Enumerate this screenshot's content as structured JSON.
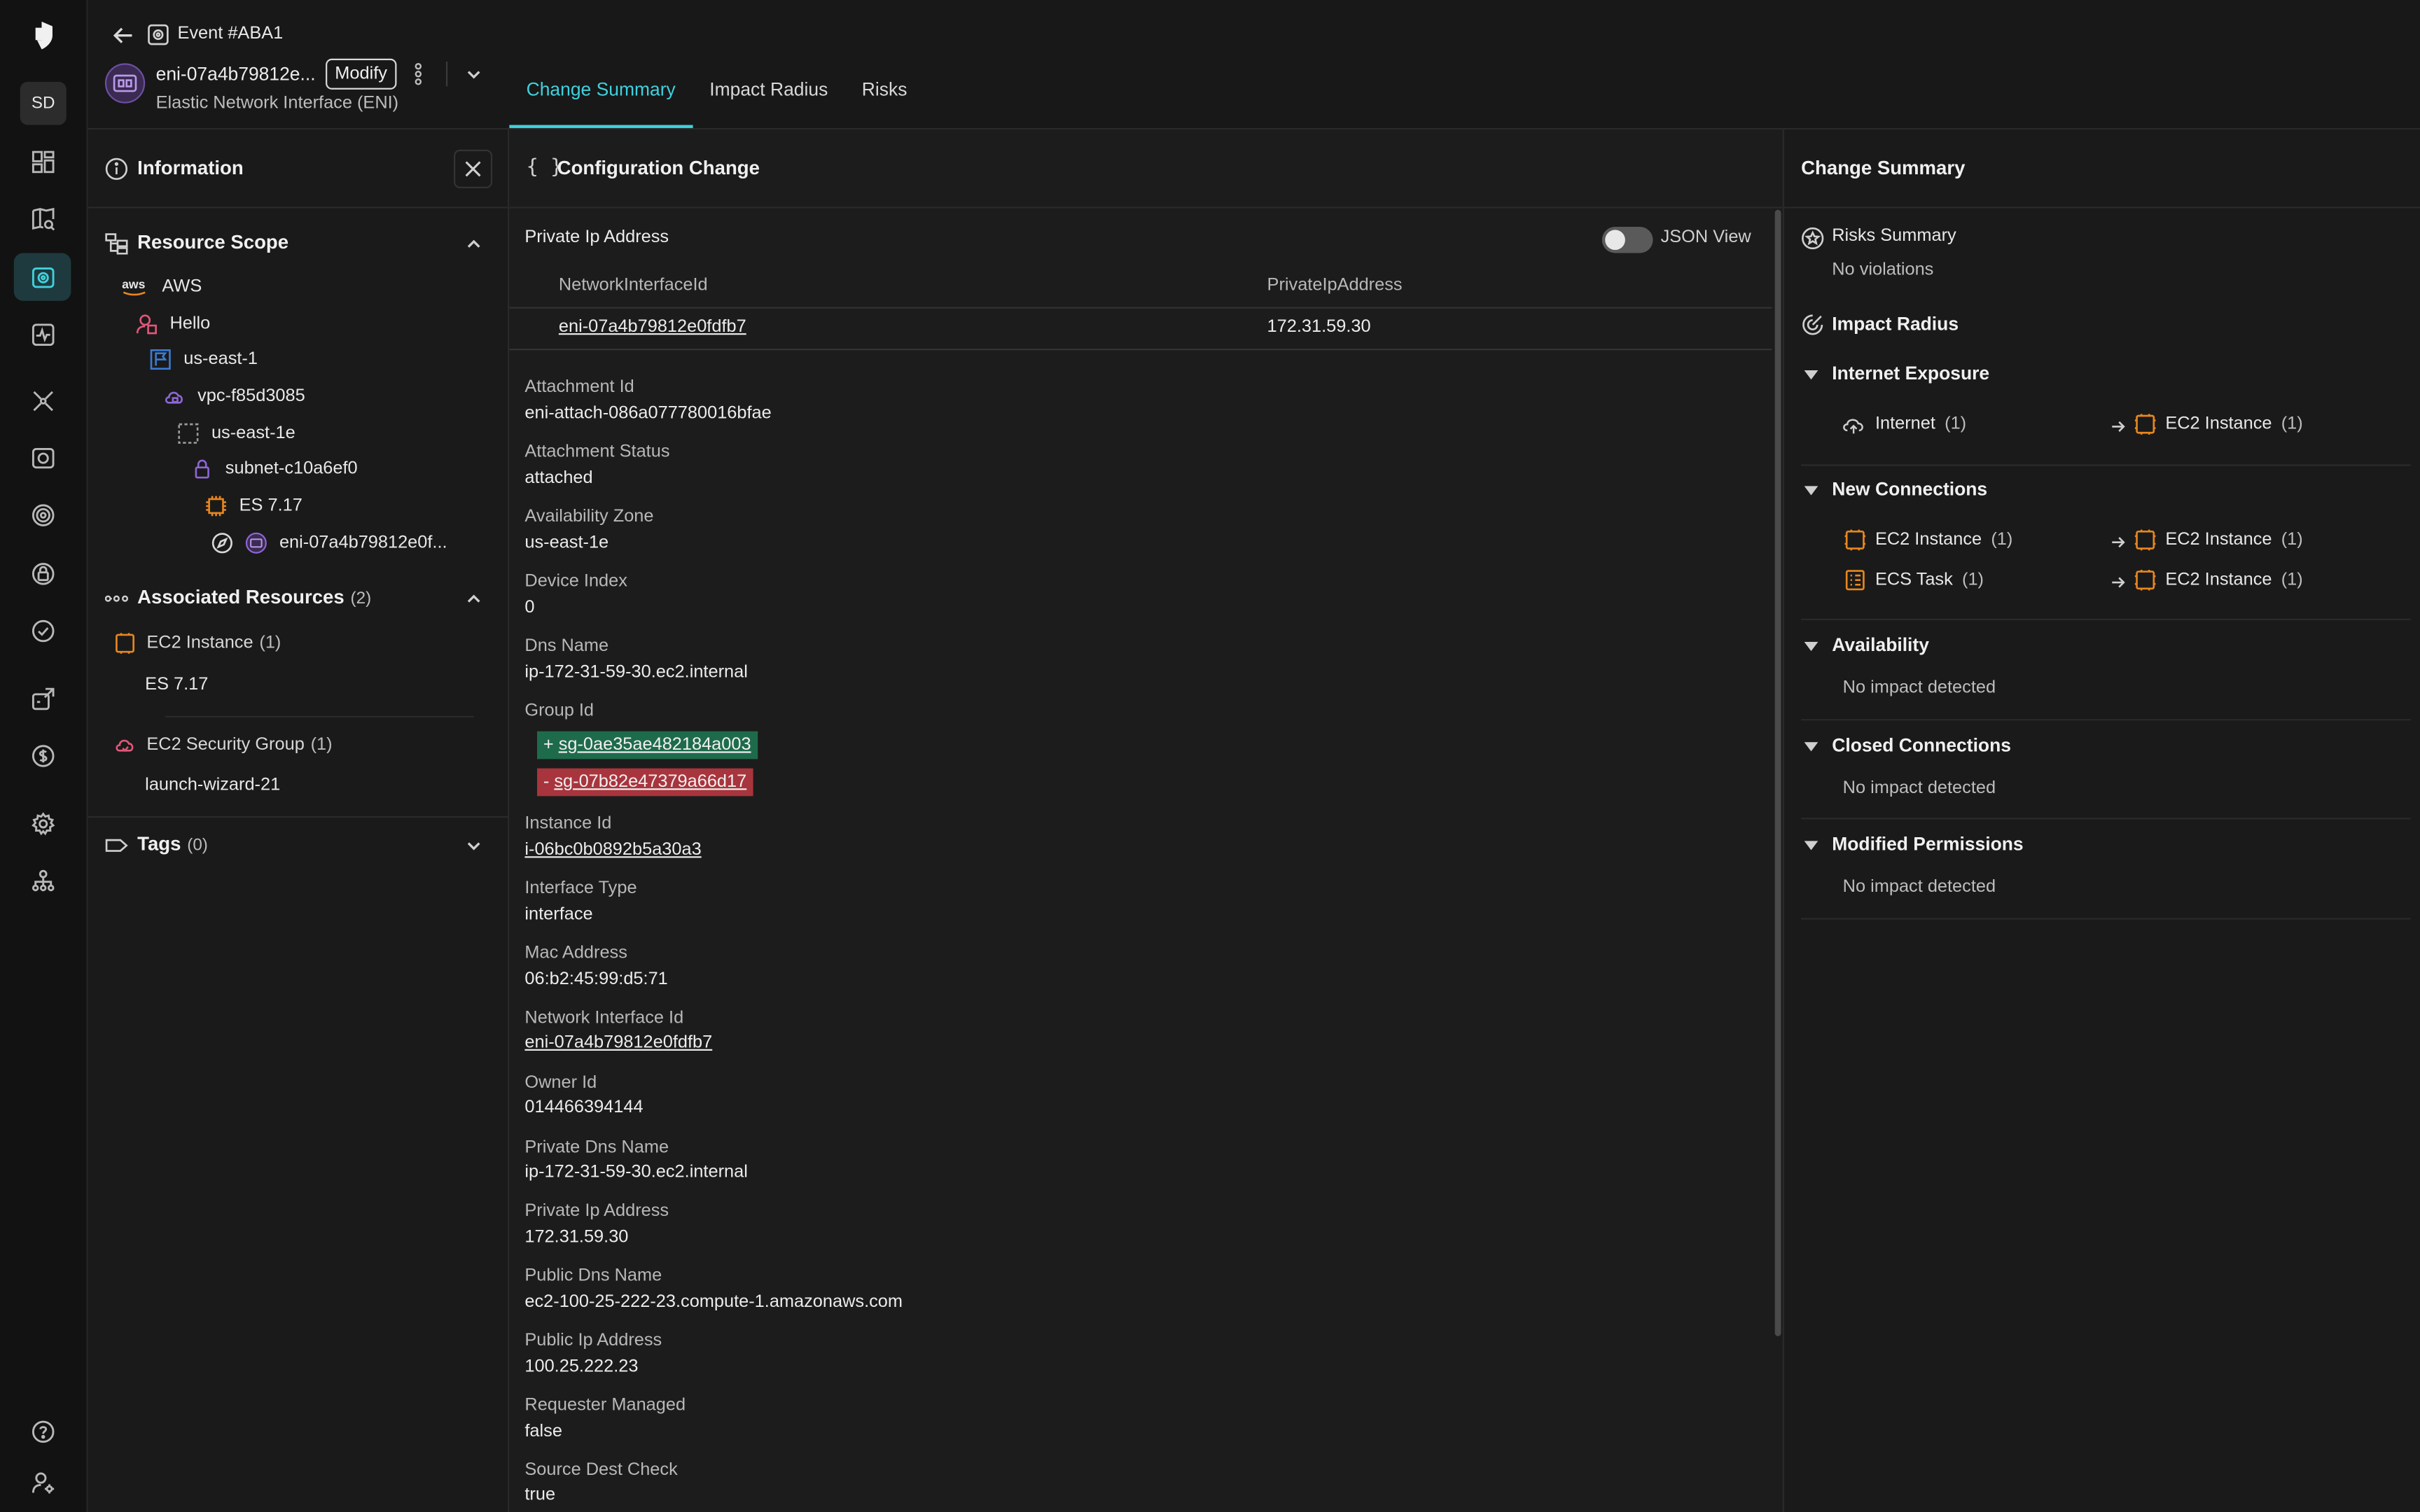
{
  "colors": {
    "accent": "#3fd1dd",
    "added": "#1e6b4c",
    "removed": "#a8353d",
    "aws_orange": "#e8871e",
    "purple": "#8d66d6",
    "pink": "#e0577a"
  },
  "rail": {
    "avatar": "SD"
  },
  "header": {
    "event_title": "Event #ABA1",
    "resource_name": "eni-07a4b79812e...",
    "modify_label": "Modify",
    "resource_type": "Elastic Network Interface (ENI)",
    "tabs": [
      {
        "label": "Change Summary",
        "active": true
      },
      {
        "label": "Impact Radius",
        "active": false
      },
      {
        "label": "Risks",
        "active": false
      }
    ]
  },
  "left_panel": {
    "title": "Information",
    "resource_scope": {
      "title": "Resource Scope",
      "tree": [
        {
          "label": "AWS",
          "icon": "aws-logo-icon"
        },
        {
          "label": "Hello",
          "icon": "account-icon"
        },
        {
          "label": "us-east-1",
          "icon": "region-flag-icon"
        },
        {
          "label": "vpc-f85d3085",
          "icon": "vpc-cloud-icon"
        },
        {
          "label": "us-east-1e",
          "icon": "availability-zone-icon"
        },
        {
          "label": "subnet-c10a6ef0",
          "icon": "subnet-lock-icon"
        },
        {
          "label": "ES 7.17",
          "icon": "ec2-chip-icon"
        },
        {
          "label": "eni-07a4b79812e0f...",
          "icon": "eni-icon"
        }
      ]
    },
    "associated": {
      "title": "Associated Resources",
      "count": "(2)",
      "groups": [
        {
          "label": "EC2 Instance",
          "count": "(1)",
          "item": "ES 7.17"
        },
        {
          "label": "EC2 Security Group",
          "count": "(1)",
          "item": "launch-wizard-21"
        }
      ]
    },
    "tags": {
      "title": "Tags",
      "count": "(0)"
    }
  },
  "config": {
    "title": "Configuration Change",
    "private_ip_title": "Private Ip Address",
    "json_view_label": "JSON View",
    "json_view_on": false,
    "table": {
      "headers": [
        "NetworkInterfaceId",
        "PrivateIpAddress"
      ],
      "rows": [
        [
          "eni-07a4b79812e0fdfb7",
          "172.31.59.30"
        ]
      ]
    },
    "fields": [
      {
        "label": "Attachment Id",
        "value": "eni-attach-086a077780016bfae"
      },
      {
        "label": "Attachment Status",
        "value": "attached"
      },
      {
        "label": "Availability Zone",
        "value": "us-east-1e"
      },
      {
        "label": "Device Index",
        "value": "0"
      },
      {
        "label": "Dns Name",
        "value": "ip-172-31-59-30.ec2.internal"
      }
    ],
    "group_id": {
      "label": "Group Id",
      "added_prefix": "+",
      "added": "sg-0ae35ae482184a003",
      "removed_prefix": "-",
      "removed": "sg-07b82e47379a66d17"
    },
    "fields2": [
      {
        "label": "Instance Id",
        "value": "i-06bc0b0892b5a30a3",
        "link": true
      },
      {
        "label": "Interface Type",
        "value": "interface"
      },
      {
        "label": "Mac Address",
        "value": "06:b2:45:99:d5:71"
      },
      {
        "label": "Network Interface Id",
        "value": "eni-07a4b79812e0fdfb7",
        "link": true
      },
      {
        "label": "Owner Id",
        "value": "014466394144"
      },
      {
        "label": "Private Dns Name",
        "value": "ip-172-31-59-30.ec2.internal"
      },
      {
        "label": "Private Ip Address",
        "value": "172.31.59.30"
      },
      {
        "label": "Public Dns Name",
        "value": "ec2-100-25-222-23.compute-1.amazonaws.com"
      },
      {
        "label": "Public Ip Address",
        "value": "100.25.222.23"
      },
      {
        "label": "Requester Managed",
        "value": "false"
      },
      {
        "label": "Source Dest Check",
        "value": "true"
      }
    ]
  },
  "summary": {
    "title": "Change Summary",
    "risks_title": "Risks Summary",
    "risks_value": "No violations",
    "impact_title": "Impact Radius",
    "sections": {
      "internet_exposure": {
        "title": "Internet Exposure",
        "from": {
          "label": "Internet",
          "count": "(1)"
        },
        "to": {
          "label": "EC2 Instance",
          "count": "(1)"
        }
      },
      "new_connections": {
        "title": "New Connections",
        "rows": [
          {
            "from": "EC2 Instance",
            "from_count": "(1)",
            "to": "EC2 Instance",
            "to_count": "(1)"
          },
          {
            "from": "ECS Task",
            "from_count": "(1)",
            "to": "EC2 Instance",
            "to_count": "(1)"
          }
        ]
      },
      "availability": {
        "title": "Availability",
        "value": "No impact detected"
      },
      "closed_connections": {
        "title": "Closed Connections",
        "value": "No impact detected"
      },
      "modified_permissions": {
        "title": "Modified Permissions",
        "value": "No impact detected"
      }
    }
  }
}
